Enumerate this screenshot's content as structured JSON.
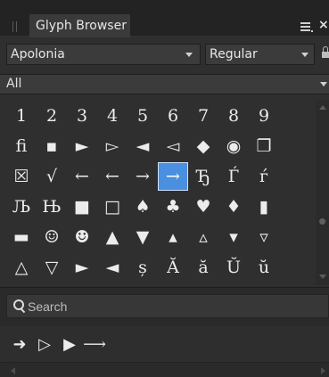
{
  "panel": {
    "title": "Glyph Browser",
    "menu_icon": "hamburger-menu-icon",
    "close_symbol": "×"
  },
  "font_family_select": {
    "value": "Apolonia"
  },
  "font_style_select": {
    "value": "Regular"
  },
  "filter_select": {
    "value": "All"
  },
  "glyph_grid": {
    "rows": [
      [
        "1",
        "2",
        "3",
        "4",
        "5",
        "6",
        "7",
        "8",
        "9"
      ],
      [
        "ﬁ",
        "▪",
        "►",
        "▻",
        "◄",
        "◅",
        "◆",
        "◉",
        "❐"
      ],
      [
        "☒",
        "√",
        "←",
        "←",
        "→",
        "→",
        "Ђ",
        "Ѓ",
        "ѓ"
      ],
      [
        "Љ",
        "Њ",
        "■",
        "□",
        "♠",
        "♣",
        "♥",
        "♦",
        "▮"
      ],
      [
        "▬",
        "☺",
        "☻",
        "▲",
        "▼",
        "▴",
        "▵",
        "▾",
        "▿"
      ],
      [
        "△",
        "▽",
        "►",
        "◄",
        "ș",
        "Ă",
        "ă",
        "Ŭ",
        "ŭ"
      ]
    ],
    "selected": {
      "row": 2,
      "col": 5
    }
  },
  "search": {
    "placeholder": "Search",
    "value": ""
  },
  "recent_glyphs": [
    "➜",
    "▷",
    "▶",
    "⟶"
  ],
  "colors": {
    "panel_bg": "#2f2f2f",
    "tab_bg": "#3a3a3a",
    "selection": "#4a8fe0",
    "text": "#e6e6e6"
  }
}
